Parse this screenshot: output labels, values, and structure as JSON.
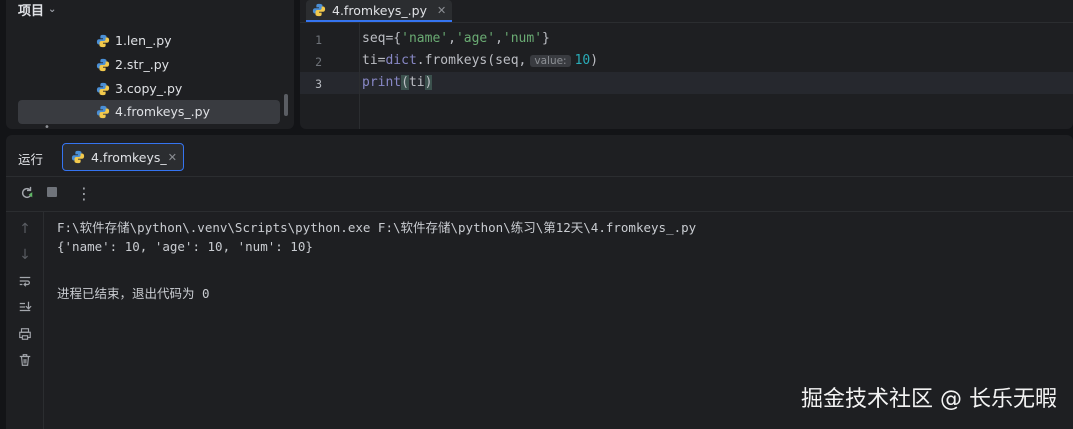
{
  "project": {
    "title": "项目",
    "files": [
      {
        "name": "1.len_.py"
      },
      {
        "name": "2.str_.py"
      },
      {
        "name": "3.copy_.py"
      },
      {
        "name": "4.fromkeys_.py",
        "selected": true
      }
    ]
  },
  "editor": {
    "tab_label": "4.fromkeys_.py",
    "line_numbers": [
      "1",
      "2",
      "3"
    ],
    "lines": {
      "l1": {
        "a": "seq={",
        "s1": "'name'",
        "c1": ",",
        "s2": "'age'",
        "c2": ",",
        "s3": "'num'",
        "b": "}"
      },
      "l2": {
        "a": "ti=",
        "fn": "dict",
        "b": ".fromkeys(seq,",
        "hint": "value:",
        "num": "10",
        "c": ")"
      },
      "l3": {
        "fn": "print",
        "p1": "(",
        "arg": "ti",
        "p2": ")"
      }
    }
  },
  "run": {
    "title": "运行",
    "tab_label": "4.fromkeys_",
    "console": [
      "F:\\软件存储\\python\\.venv\\Scripts\\python.exe F:\\软件存储\\python\\练习\\第12天\\4.fromkeys_.py",
      "{'name': 10, 'age': 10, 'num': 10}",
      "",
      "进程已结束，退出代码为 0"
    ]
  },
  "watermark": "掘金技术社区 @ 长乐无暇",
  "colors": {
    "accent": "#3574f0",
    "string": "#6aab73",
    "number": "#2aacb8"
  }
}
